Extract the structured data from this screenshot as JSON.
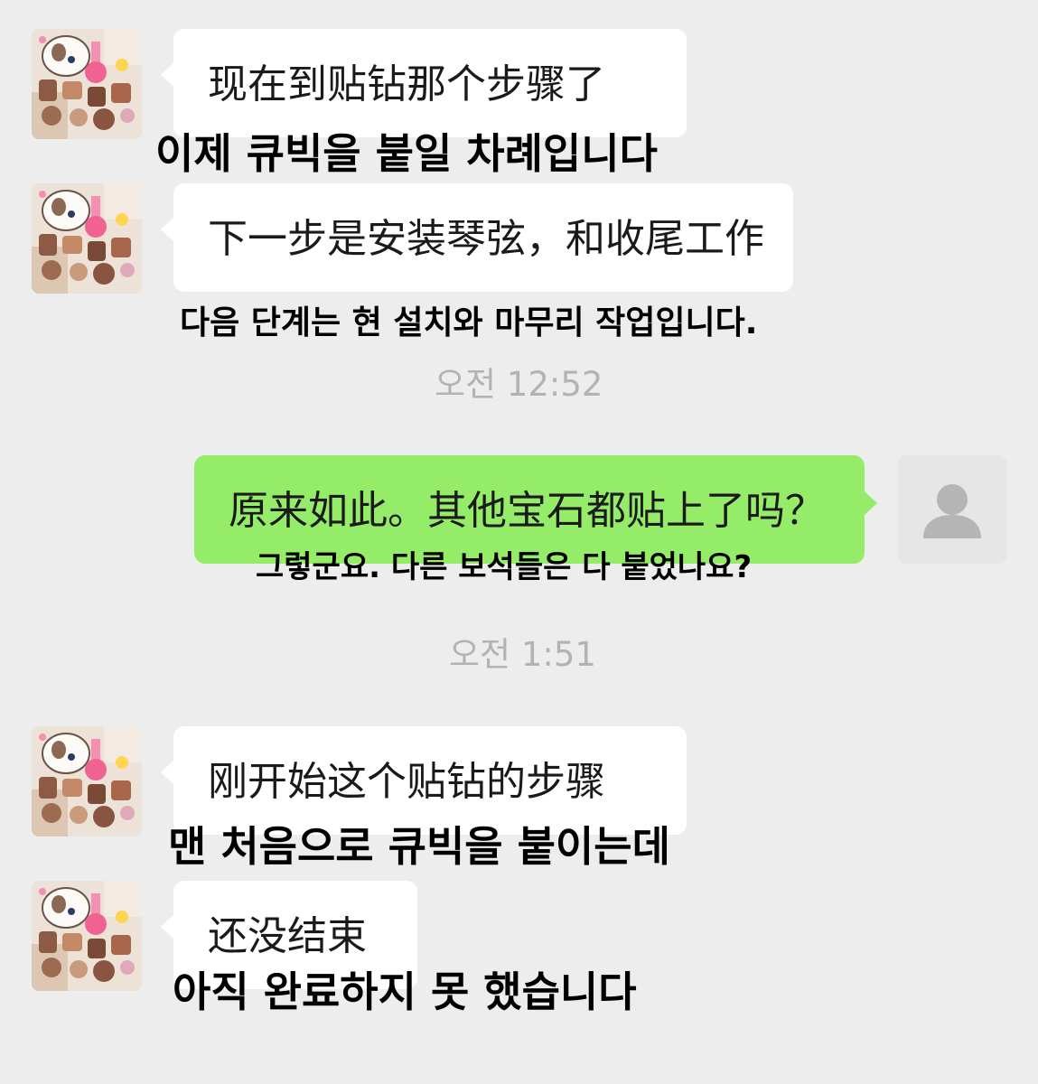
{
  "messages": [
    {
      "sender": "other",
      "text": "现在到贴钻那个步骤了",
      "translation": "이제 큐빅을 붙일 차례입니다"
    },
    {
      "sender": "other",
      "text": "下一步是安装琴弦，和收尾工作",
      "translation": "다음 단계는 현 설치와 마무리 작업입니다."
    },
    {
      "sender": "me",
      "text": "原来如此。其他宝石都贴上了吗？",
      "translation": "그렇군요. 다른 보석들은 다 붙었나요?"
    },
    {
      "sender": "other",
      "text": "刚开始这个贴钻的步骤",
      "translation": "맨 처음으로 큐빅을 붙이는데"
    },
    {
      "sender": "other",
      "text": "还没结束",
      "translation": "아직 완료하지 못 했습니다"
    }
  ],
  "timestamps": [
    "오전 12:52",
    "오전 1:51"
  ],
  "colors": {
    "background": "#ededed",
    "incoming_bubble": "#ffffff",
    "outgoing_bubble": "#95ec69",
    "timestamp_text": "#b3b3b3"
  },
  "icons": {
    "other_avatar": "cartoon-cat-sticker-avatar",
    "my_avatar": "default-person-avatar"
  }
}
